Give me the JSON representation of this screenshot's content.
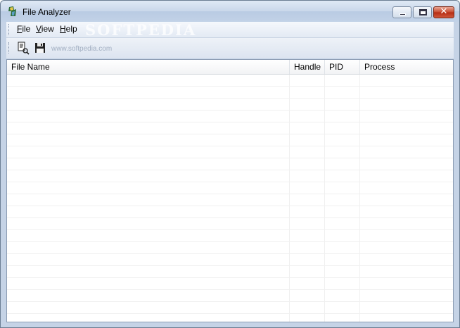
{
  "window": {
    "title": "File Analyzer",
    "controls": {
      "minimize": "minimize",
      "maximize": "maximize",
      "close": "✕"
    }
  },
  "menu": [
    {
      "label": "File"
    },
    {
      "label": "View"
    },
    {
      "label": "Help"
    }
  ],
  "toolbar": {
    "buttons": [
      {
        "icon": "open-file-icon"
      },
      {
        "icon": "save-disk-icon"
      }
    ]
  },
  "watermark": {
    "logo": "SOFTPEDIA",
    "url": "www.softpedia.com"
  },
  "list": {
    "columns": [
      "File Name",
      "Handle",
      "PID",
      "Process"
    ],
    "rows": []
  },
  "colors": {
    "title_bar": "#c9d7ea",
    "close_button": "#c7482d",
    "window_frame": "#c5d3e6"
  }
}
